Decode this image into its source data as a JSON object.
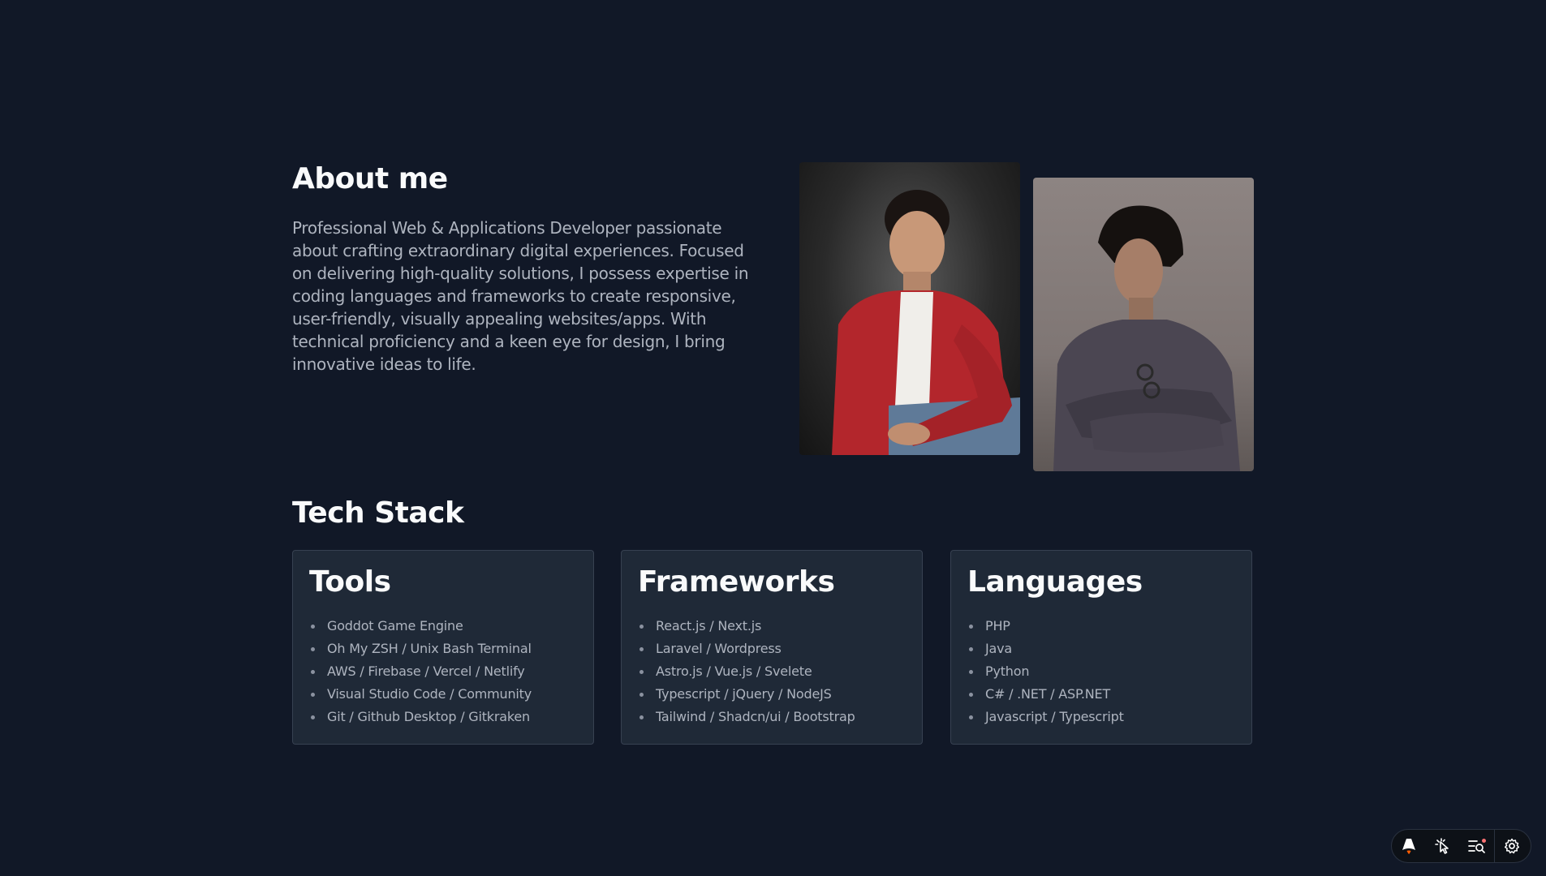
{
  "about": {
    "title": "About me",
    "description": "Professional Web & Applications Developer passionate about crafting extraordinary digital experiences. Focused on delivering high-quality solutions, I possess expertise in coding languages and frameworks to create responsive, user-friendly, visually appealing websites/apps. With technical proficiency and a keen eye for design, I bring innovative ideas to life."
  },
  "tech_stack": {
    "title": "Tech Stack",
    "cards": [
      {
        "title": "Tools",
        "items": [
          "Goddot Game Engine",
          "Oh My ZSH / Unix Bash Terminal",
          "AWS / Firebase / Vercel / Netlify",
          "Visual Studio Code / Community",
          "Git / Github Desktop / Gitkraken"
        ]
      },
      {
        "title": "Frameworks",
        "items": [
          "React.js / Next.js",
          "Laravel / Wordpress",
          "Astro.js / Vue.js / Svelete",
          "Typescript / jQuery / NodeJS",
          "Tailwind / Shadcn/ui / Bootstrap"
        ]
      },
      {
        "title": "Languages",
        "items": [
          "PHP",
          "Java",
          "Python",
          "C# / .NET / ASP.NET",
          "Javascript / Typescript"
        ]
      }
    ]
  },
  "toolbar": {
    "icons": [
      "astro-logo-icon",
      "cursor-inspect-icon",
      "audit-list-icon",
      "gear-icon"
    ],
    "notification_dot_color": "#f87171"
  },
  "colors": {
    "background": "#111827",
    "card_background": "#1f2937",
    "text_primary": "#f9fafb",
    "text_secondary": "#aeb4bf"
  }
}
